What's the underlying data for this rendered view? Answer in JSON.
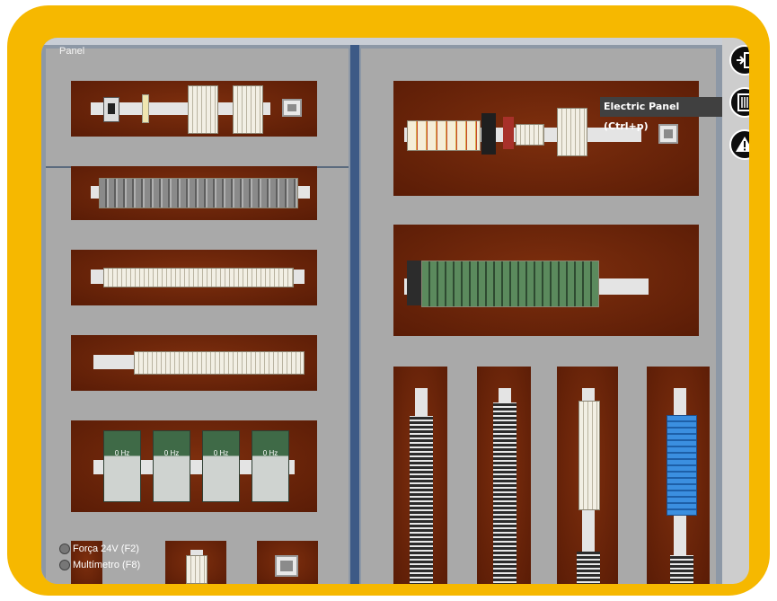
{
  "panel": {
    "title": "Panel"
  },
  "tooltip": {
    "text": "Electric Panel (Ctrl+p)"
  },
  "icons": {
    "exit": "exit-door-icon",
    "electric_panel": "electric-panel-icon",
    "warning": "warning-icon"
  },
  "inverters": {
    "display": "0 Hz"
  },
  "power_options": [
    {
      "label": "Força 24V (F2)"
    },
    {
      "label": "Multímetro (F8)"
    }
  ],
  "colors": {
    "frame": "#f6b800",
    "plate": "#6a2409",
    "panel_bg": "#a9a9a9",
    "divider": "#3d5a86",
    "tooltip_bg": "#404040"
  }
}
